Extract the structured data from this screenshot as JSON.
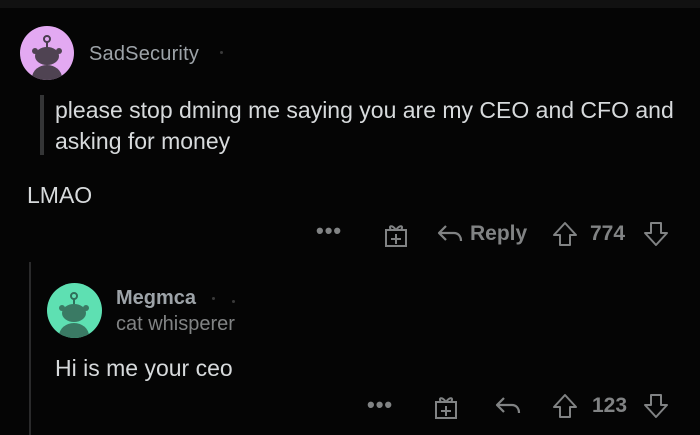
{
  "comments": [
    {
      "username": "SadSecurity",
      "avatar_color": "#e3a9f2",
      "quote": "please stop dming me saying you are my CEO and CFO and asking for money",
      "body": "LMAO",
      "actions": {
        "more_icon": "more-dots-icon",
        "gift_icon": "gift-icon",
        "reply_label": "Reply",
        "upvote_icon": "arrow-up-icon",
        "score": "774",
        "downvote_icon": "arrow-down-icon"
      }
    },
    {
      "username": "Megmca",
      "flair": "cat whisperer",
      "avatar_color": "#5ee0b2",
      "body": "Hi is me your ceo",
      "actions": {
        "more_icon": "more-dots-icon",
        "gift_icon": "gift-icon",
        "reply_icon": "reply-arrow-icon",
        "upvote_icon": "arrow-up-icon",
        "score": "123",
        "downvote_icon": "arrow-down-icon"
      }
    }
  ],
  "colors": {
    "background": "#050505",
    "text": "#d7dadc",
    "muted": "#818384"
  }
}
